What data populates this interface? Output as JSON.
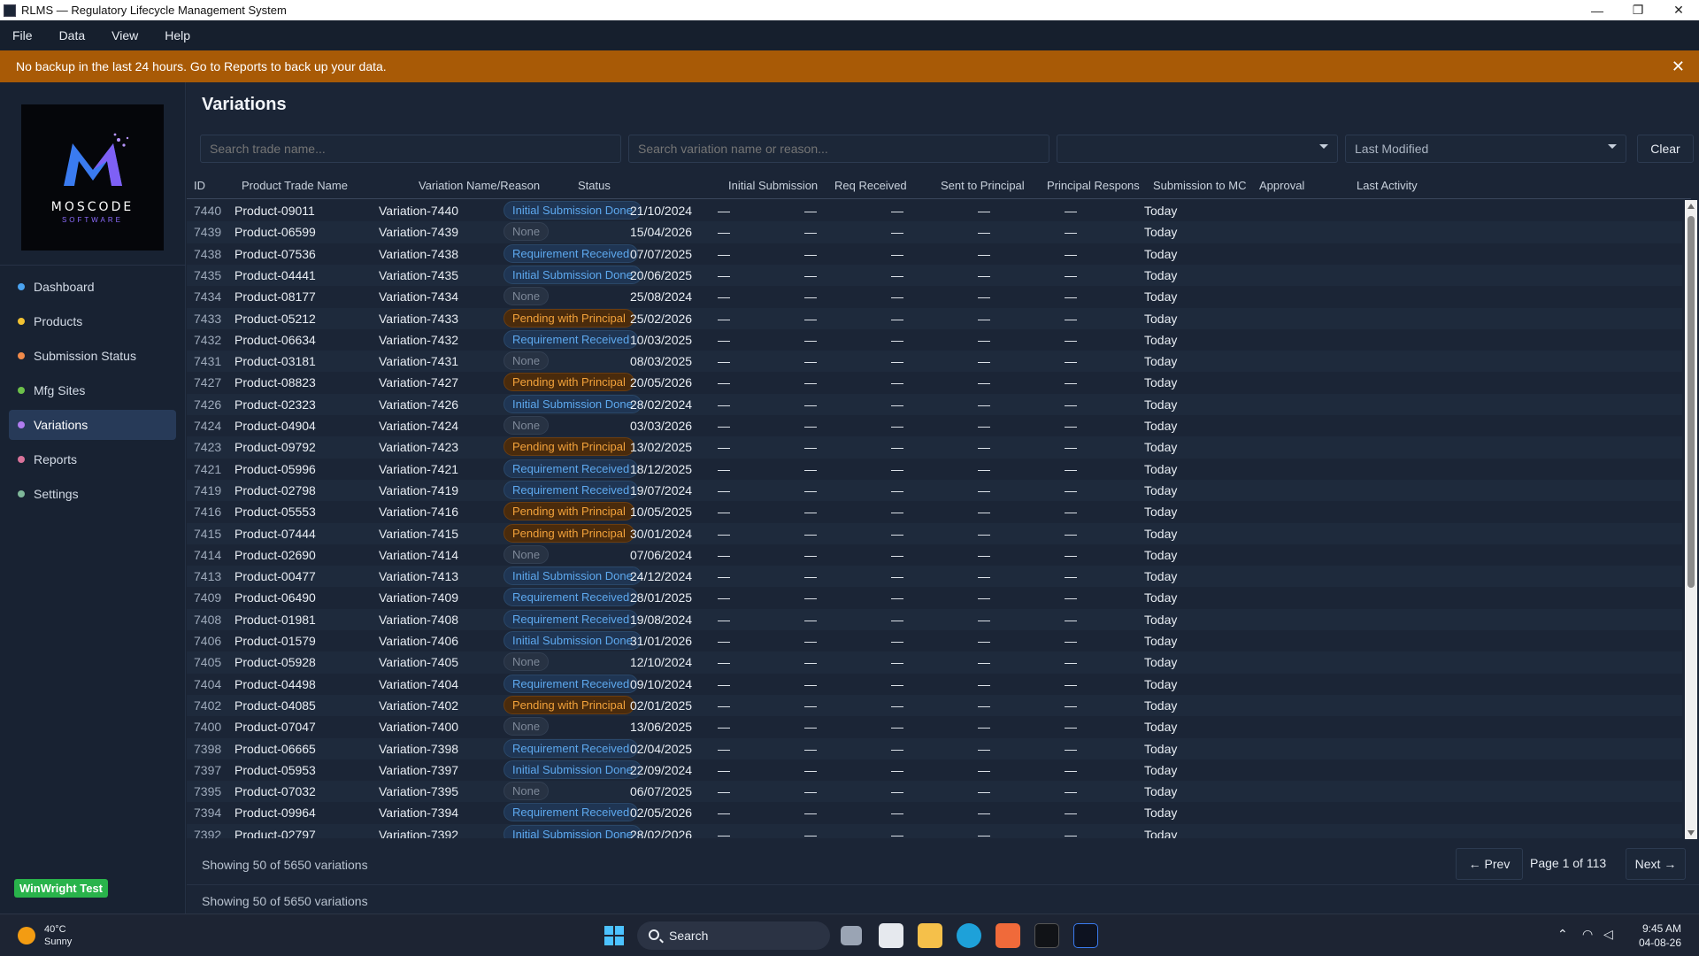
{
  "window": {
    "title": "RLMS — Regulatory Lifecycle Management System"
  },
  "menu": [
    "File",
    "Data",
    "View",
    "Help"
  ],
  "banner": {
    "text": "No backup in the last 24 hours. Go to Reports to back up your data."
  },
  "logo": {
    "name": "MOSCODE",
    "sub": "SOFTWARE"
  },
  "nav": [
    {
      "label": "Dashboard",
      "color": "#4aa3f0",
      "active": false
    },
    {
      "label": "Products",
      "color": "#f1c232",
      "active": false
    },
    {
      "label": "Submission Status",
      "color": "#f08a4a",
      "active": false
    },
    {
      "label": "Mfg Sites",
      "color": "#6cc04a",
      "active": false
    },
    {
      "label": "Variations",
      "color": "#b07cf0",
      "active": true
    },
    {
      "label": "Reports",
      "color": "#d9739a",
      "active": false
    },
    {
      "label": "Settings",
      "color": "#7fb89a",
      "active": false
    }
  ],
  "test_badge": "WinWright Test",
  "page": {
    "title": "Variations",
    "search_trade_placeholder": "Search trade name...",
    "search_variation_placeholder": "Search variation name or reason...",
    "filter_value": "",
    "sort_value": "Last Modified",
    "clear_label": "Clear"
  },
  "columns": [
    "ID",
    "Product Trade Name",
    "Variation Name/Reason",
    "Status",
    "Initial Submission",
    "Req Received",
    "Sent to Principal",
    "Principal Respons",
    "Submission to MC",
    "Approval",
    "Last Activity"
  ],
  "status_labels": {
    "initial": "Initial Submission Done",
    "none": "None",
    "req": "Requirement Received",
    "pending": "Pending with Principal"
  },
  "dash": "—",
  "rows": [
    {
      "id": "7440",
      "product": "Product-09011",
      "variation": "Variation-7440",
      "status": "initial",
      "initial": "21/10/2024",
      "last": "Today"
    },
    {
      "id": "7439",
      "product": "Product-06599",
      "variation": "Variation-7439",
      "status": "none",
      "initial": "15/04/2026",
      "last": "Today"
    },
    {
      "id": "7438",
      "product": "Product-07536",
      "variation": "Variation-7438",
      "status": "req",
      "initial": "07/07/2025",
      "last": "Today"
    },
    {
      "id": "7435",
      "product": "Product-04441",
      "variation": "Variation-7435",
      "status": "initial",
      "initial": "20/06/2025",
      "last": "Today"
    },
    {
      "id": "7434",
      "product": "Product-08177",
      "variation": "Variation-7434",
      "status": "none",
      "initial": "25/08/2024",
      "last": "Today"
    },
    {
      "id": "7433",
      "product": "Product-05212",
      "variation": "Variation-7433",
      "status": "pending",
      "initial": "25/02/2026",
      "last": "Today"
    },
    {
      "id": "7432",
      "product": "Product-06634",
      "variation": "Variation-7432",
      "status": "req",
      "initial": "10/03/2025",
      "last": "Today"
    },
    {
      "id": "7431",
      "product": "Product-03181",
      "variation": "Variation-7431",
      "status": "none",
      "initial": "08/03/2025",
      "last": "Today"
    },
    {
      "id": "7427",
      "product": "Product-08823",
      "variation": "Variation-7427",
      "status": "pending",
      "initial": "20/05/2026",
      "last": "Today"
    },
    {
      "id": "7426",
      "product": "Product-02323",
      "variation": "Variation-7426",
      "status": "initial",
      "initial": "28/02/2024",
      "last": "Today"
    },
    {
      "id": "7424",
      "product": "Product-04904",
      "variation": "Variation-7424",
      "status": "none",
      "initial": "03/03/2026",
      "last": "Today"
    },
    {
      "id": "7423",
      "product": "Product-09792",
      "variation": "Variation-7423",
      "status": "pending",
      "initial": "13/02/2025",
      "last": "Today"
    },
    {
      "id": "7421",
      "product": "Product-05996",
      "variation": "Variation-7421",
      "status": "req",
      "initial": "18/12/2025",
      "last": "Today"
    },
    {
      "id": "7419",
      "product": "Product-02798",
      "variation": "Variation-7419",
      "status": "req",
      "initial": "19/07/2024",
      "last": "Today"
    },
    {
      "id": "7416",
      "product": "Product-05553",
      "variation": "Variation-7416",
      "status": "pending",
      "initial": "10/05/2025",
      "last": "Today"
    },
    {
      "id": "7415",
      "product": "Product-07444",
      "variation": "Variation-7415",
      "status": "pending",
      "initial": "30/01/2024",
      "last": "Today"
    },
    {
      "id": "7414",
      "product": "Product-02690",
      "variation": "Variation-7414",
      "status": "none",
      "initial": "07/06/2024",
      "last": "Today"
    },
    {
      "id": "7413",
      "product": "Product-00477",
      "variation": "Variation-7413",
      "status": "initial",
      "initial": "24/12/2024",
      "last": "Today"
    },
    {
      "id": "7409",
      "product": "Product-06490",
      "variation": "Variation-7409",
      "status": "req",
      "initial": "28/01/2025",
      "last": "Today"
    },
    {
      "id": "7408",
      "product": "Product-01981",
      "variation": "Variation-7408",
      "status": "req",
      "initial": "19/08/2024",
      "last": "Today"
    },
    {
      "id": "7406",
      "product": "Product-01579",
      "variation": "Variation-7406",
      "status": "initial",
      "initial": "31/01/2026",
      "last": "Today"
    },
    {
      "id": "7405",
      "product": "Product-05928",
      "variation": "Variation-7405",
      "status": "none",
      "initial": "12/10/2024",
      "last": "Today"
    },
    {
      "id": "7404",
      "product": "Product-04498",
      "variation": "Variation-7404",
      "status": "req",
      "initial": "09/10/2024",
      "last": "Today"
    },
    {
      "id": "7402",
      "product": "Product-04085",
      "variation": "Variation-7402",
      "status": "pending",
      "initial": "02/01/2025",
      "last": "Today"
    },
    {
      "id": "7400",
      "product": "Product-07047",
      "variation": "Variation-7400",
      "status": "none",
      "initial": "13/06/2025",
      "last": "Today"
    },
    {
      "id": "7398",
      "product": "Product-06665",
      "variation": "Variation-7398",
      "status": "req",
      "initial": "02/04/2025",
      "last": "Today"
    },
    {
      "id": "7397",
      "product": "Product-05953",
      "variation": "Variation-7397",
      "status": "initial",
      "initial": "22/09/2024",
      "last": "Today"
    },
    {
      "id": "7395",
      "product": "Product-07032",
      "variation": "Variation-7395",
      "status": "none",
      "initial": "06/07/2025",
      "last": "Today"
    },
    {
      "id": "7394",
      "product": "Product-09964",
      "variation": "Variation-7394",
      "status": "req",
      "initial": "02/05/2026",
      "last": "Today"
    },
    {
      "id": "7392",
      "product": "Product-02797",
      "variation": "Variation-7392",
      "status": "initial",
      "initial": "28/02/2026",
      "last": "Today"
    }
  ],
  "pager": {
    "showing": "Showing 50 of 5650 variations",
    "prev": "← Prev",
    "page_label": "Page 1 of 113",
    "next": "Next →",
    "footer_status": "Showing 50 of 5650 variations"
  },
  "taskbar": {
    "temp": "40°C",
    "condition": "Sunny",
    "search": "Search",
    "time": "9:45 AM",
    "date": "04-08-26"
  }
}
